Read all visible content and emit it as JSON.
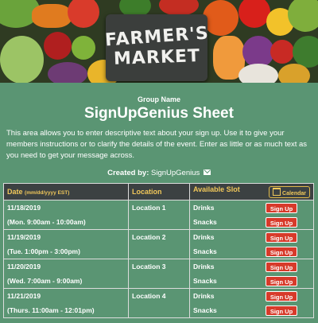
{
  "banner": {
    "sign_line1": "FARMER'S",
    "sign_line2": "MARKET"
  },
  "header": {
    "group_name": "Group Name",
    "title": "SignUpGenius Sheet",
    "description": "This area allows you to enter descriptive text about your sign up. Use it to give your members instructions or to clarify the details of the event. Enter as little or as much text as you need to get your message across.",
    "created_by_label": "Created by:",
    "creator": "SignUpGenius"
  },
  "table": {
    "col_date": "Date",
    "col_date_format": "(mm/dd/yyyy EST)",
    "col_location": "Location",
    "col_slot": "Available Slot",
    "calendar_label": "Calendar",
    "signup_label": "Sign Up",
    "rows": [
      {
        "date": "11/18/2019",
        "time": "(Mon. 9:00am - 10:00am)",
        "location": "Location 1",
        "slots": [
          "Drinks",
          "Snacks"
        ]
      },
      {
        "date": "11/19/2019",
        "time": "(Tue. 1:00pm - 3:00pm)",
        "location": "Location 2",
        "slots": [
          "Drinks",
          "Snacks"
        ]
      },
      {
        "date": "11/20/2019",
        "time": "(Wed. 7:00am - 9:00am)",
        "location": "Location 3",
        "slots": [
          "Drinks",
          "Snacks"
        ]
      },
      {
        "date": "11/21/2019",
        "time": "(Thurs. 11:00am - 12:01pm)",
        "location": "Location 4",
        "slots": [
          "Drinks",
          "Snacks"
        ]
      }
    ]
  },
  "colors": {
    "background": "#5a9573",
    "header_bg": "#3c4142",
    "header_text": "#f0c75a",
    "signup_button": "#d73a2a"
  }
}
